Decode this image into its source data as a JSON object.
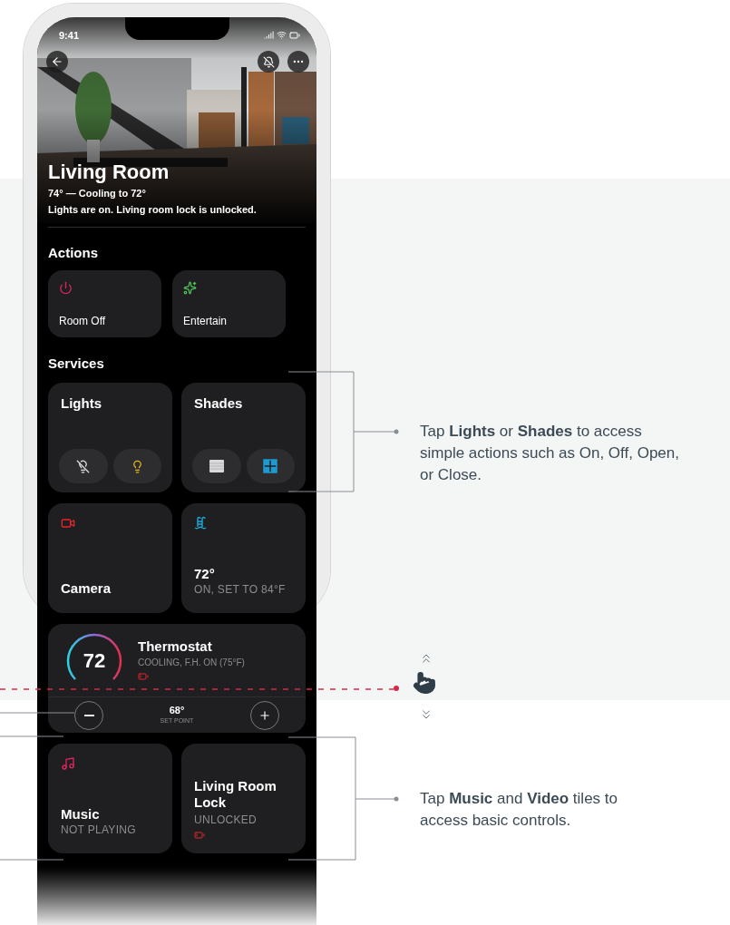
{
  "status_bar": {
    "time": "9:41"
  },
  "room": {
    "title": "Living Room",
    "climate": "74° — Cooling to 72°",
    "summary": "Lights are on. Living room lock is unlocked."
  },
  "actions": {
    "heading": "Actions",
    "items": [
      {
        "kind": "power",
        "label": "Room Off"
      },
      {
        "kind": "sparkle",
        "label": "Entertain"
      }
    ]
  },
  "services": {
    "heading": "Services",
    "tiles": [
      {
        "kind": "lights",
        "title": "Lights"
      },
      {
        "kind": "shades",
        "title": "Shades"
      },
      {
        "kind": "camera",
        "title": "Camera"
      },
      {
        "kind": "pool",
        "title": "72°",
        "subtitle": "ON, SET TO 84°F"
      },
      {
        "kind": "thermostat",
        "title": "Thermostat",
        "value": "72",
        "subtitle": "COOLING, F.H. ON (75°F)",
        "setpoint": "68°",
        "setpoint_label": "SET POINT"
      },
      {
        "kind": "music",
        "title": "Music",
        "subtitle": "NOT PLAYING"
      },
      {
        "kind": "lock",
        "title": "Living Room Lock",
        "subtitle": "UNLOCKED"
      }
    ]
  },
  "callouts": [
    {
      "text": "Tap **Lights** or **Shades** to access simple actions such as On, Off, Open, or Close."
    },
    {
      "text": "Tap **Music** and **Video** tiles to access basic controls."
    }
  ]
}
